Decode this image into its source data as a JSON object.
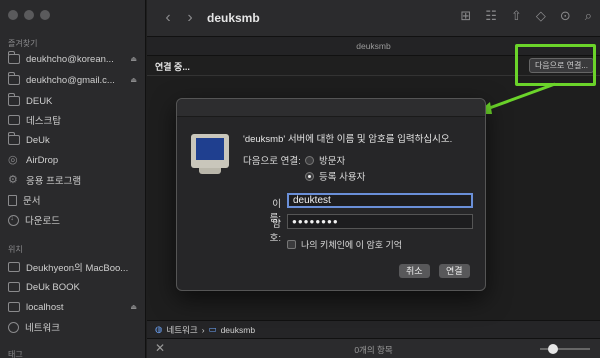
{
  "sidebar": {
    "section_favorites": "즐겨찾기",
    "section_locations": "위치",
    "section_tags": "태그",
    "favorites": [
      {
        "label": "deukhcho@korean...",
        "icon": "folder-icon",
        "eject": true
      },
      {
        "label": "deukhcho@gmail.c...",
        "icon": "folder-icon",
        "eject": true
      },
      {
        "label": "DEUK",
        "icon": "folder-icon",
        "eject": false
      },
      {
        "label": "데스크탑",
        "icon": "desktop-icon",
        "eject": false
      },
      {
        "label": "DeUk",
        "icon": "home-icon",
        "eject": false
      },
      {
        "label": "AirDrop",
        "icon": "airdrop-icon",
        "eject": false
      },
      {
        "label": "응용 프로그램",
        "icon": "applications-icon",
        "eject": false
      },
      {
        "label": "문서",
        "icon": "document-icon",
        "eject": false
      },
      {
        "label": "다운로드",
        "icon": "download-icon",
        "eject": false
      }
    ],
    "locations": [
      {
        "label": "Deukhyeon의 MacBoo...",
        "icon": "laptop-icon",
        "eject": false
      },
      {
        "label": "DeUk BOOK",
        "icon": "drive-icon",
        "eject": false
      },
      {
        "label": "localhost",
        "icon": "server-icon",
        "eject": true
      },
      {
        "label": "네트워크",
        "icon": "network-icon",
        "eject": false
      }
    ]
  },
  "window": {
    "title": "deuksmb",
    "tab_title": "deuksmb",
    "connecting_label": "연결 중...",
    "connect_as_button": "다음으로 연결..."
  },
  "pathbar": {
    "items": [
      "네트워크",
      "deuksmb"
    ],
    "separator": "›"
  },
  "statusbar": {
    "item_count": "0개의 항목"
  },
  "dialog": {
    "message": "'deuksmb' 서버에 대한 이름 및 암호를 입력하십시오.",
    "connect_as_label": "다음으로 연결:",
    "radio_guest": "방문자",
    "radio_registered": "등록 사용자",
    "selected": "등록 사용자",
    "name_label": "이름:",
    "name_value": "deuktest",
    "password_label": "암호:",
    "password_value": "●●●●●●●●",
    "remember_label": "나의 키체인에 이 암호 기억",
    "cancel_button": "취소",
    "connect_button": "연결"
  },
  "colors": {
    "highlight": "#6bd42a",
    "background": "#1e1e1e",
    "sidebar": "#2a2a2c"
  }
}
